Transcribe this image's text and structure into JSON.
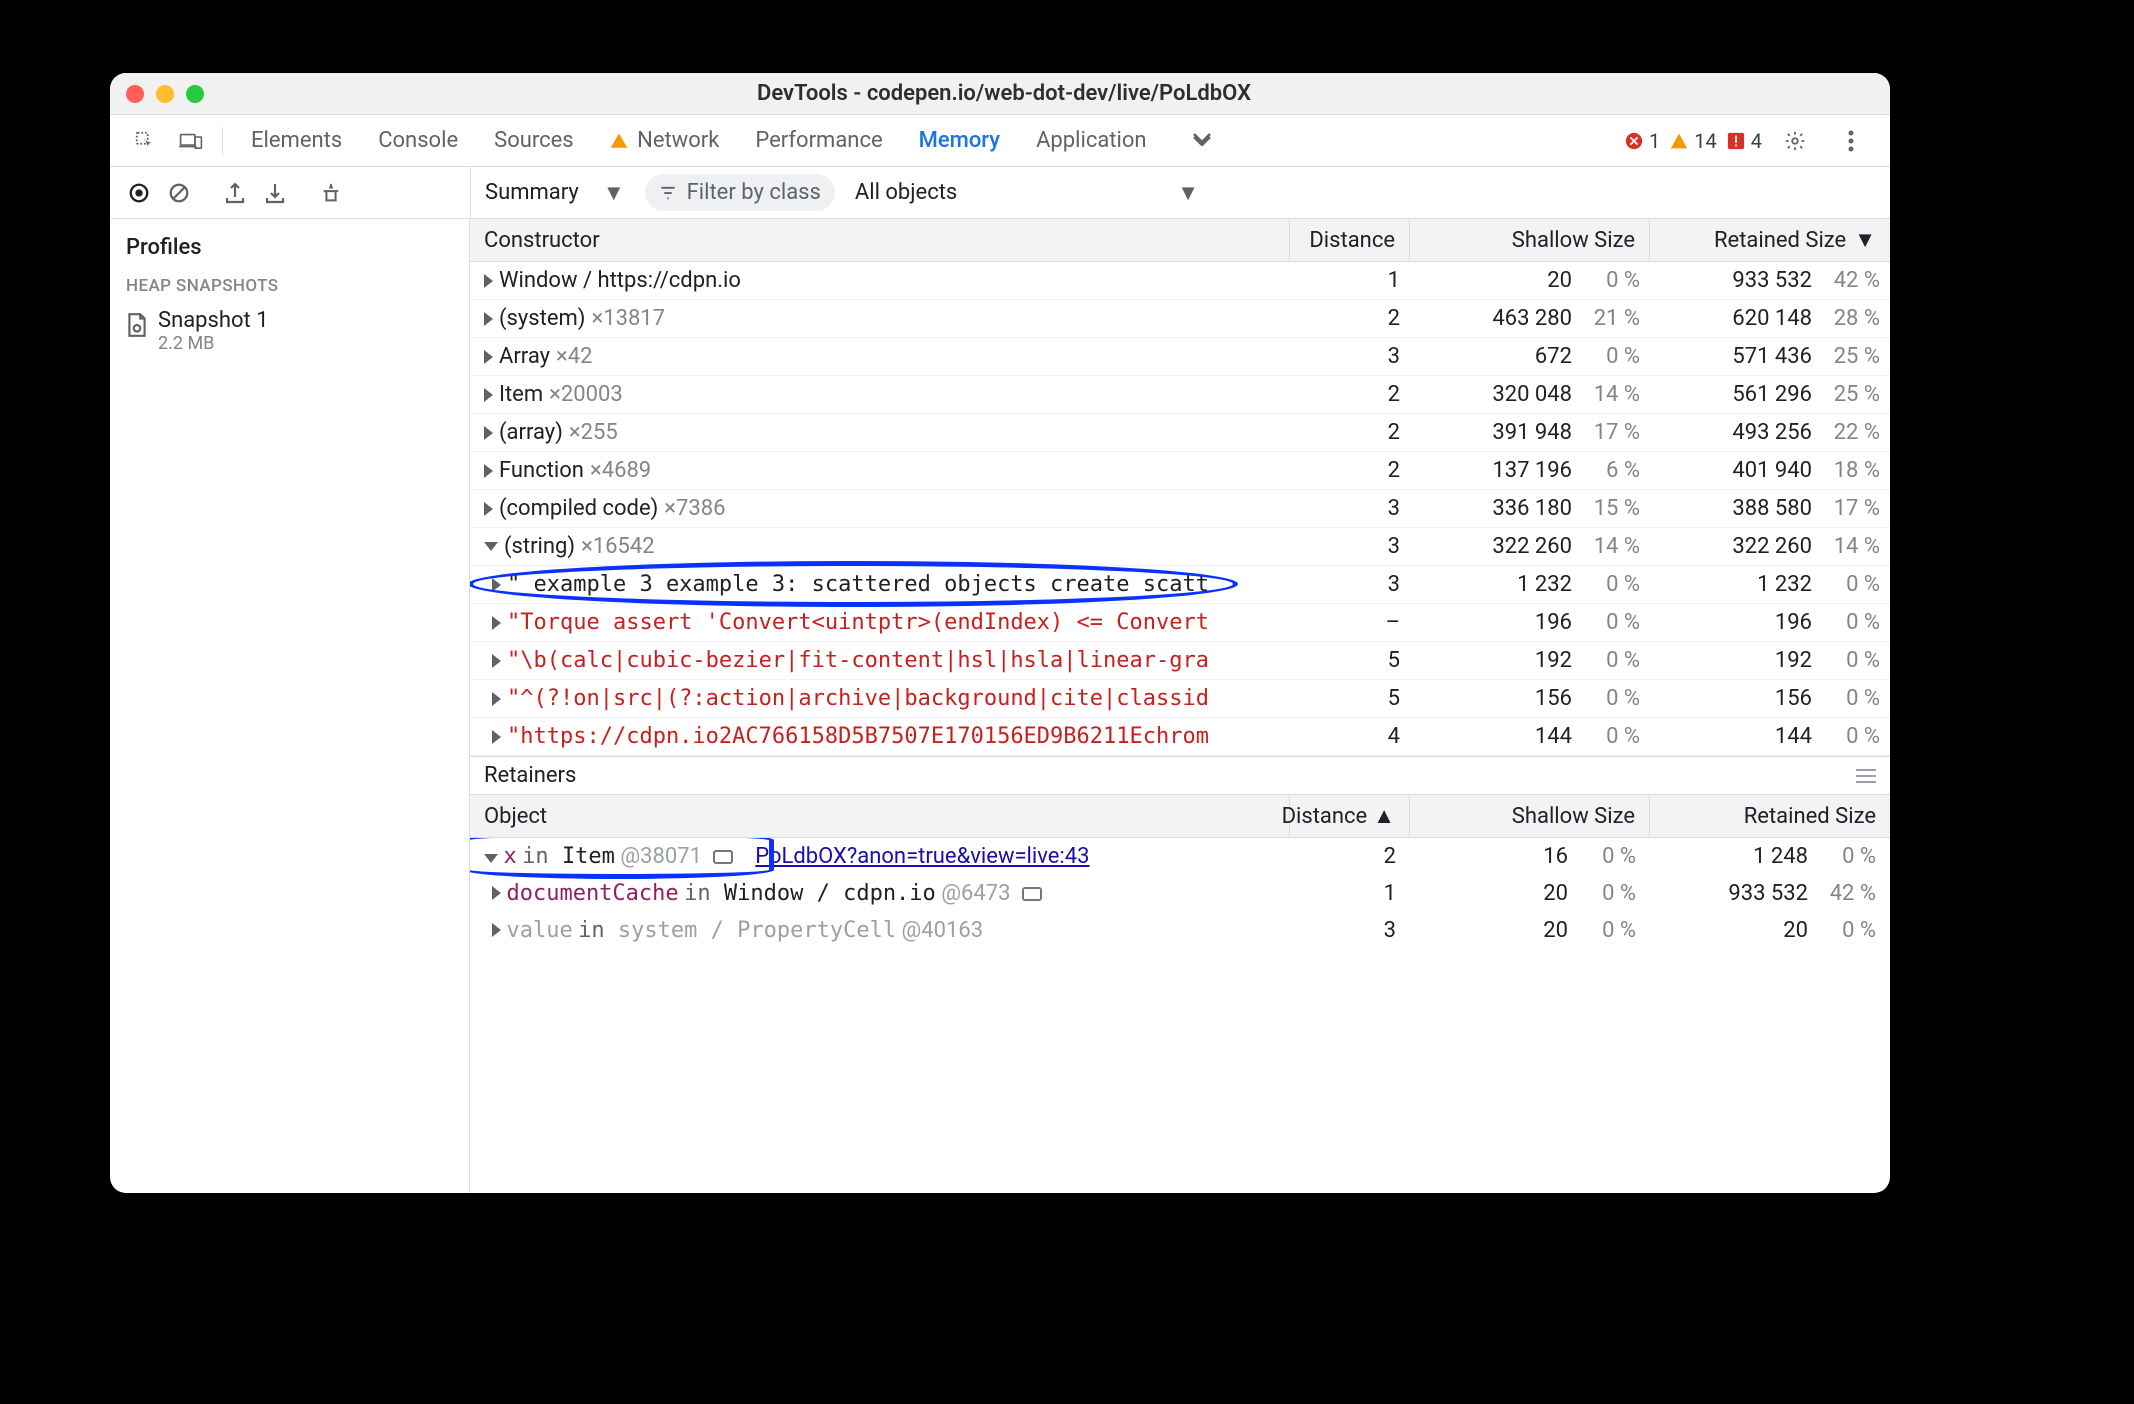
{
  "titlebar": {
    "title": "DevTools - codepen.io/web-dot-dev/live/PoLdbOX"
  },
  "tabs": {
    "elements": "Elements",
    "console": "Console",
    "sources": "Sources",
    "network": "Network",
    "performance": "Performance",
    "memory": "Memory",
    "application": "Application"
  },
  "status": {
    "errors": "1",
    "warnings": "14",
    "issues": "4"
  },
  "toolbar": {
    "summary": "Summary",
    "filter_placeholder": "Filter by class",
    "allobjects": "All objects"
  },
  "sidebar": {
    "profiles": "Profiles",
    "heap": "HEAP SNAPSHOTS",
    "snap1_title": "Snapshot 1",
    "snap1_size": "2.2 MB"
  },
  "grid": {
    "headers": {
      "constructor": "Constructor",
      "distance": "Distance",
      "shallow": "Shallow Size",
      "retained": "Retained Size"
    },
    "rows": [
      {
        "name": "Window / https://cdpn.io",
        "count": "",
        "d": "1",
        "sv": "20",
        "sp": "0 %",
        "rv": "933 532",
        "rp": "42 %",
        "expand": "r"
      },
      {
        "name": "(system)",
        "count": "×13817",
        "d": "2",
        "sv": "463 280",
        "sp": "21 %",
        "rv": "620 148",
        "rp": "28 %",
        "expand": "r"
      },
      {
        "name": "Array",
        "count": "×42",
        "d": "3",
        "sv": "672",
        "sp": "0 %",
        "rv": "571 436",
        "rp": "25 %",
        "expand": "r"
      },
      {
        "name": "Item",
        "count": "×20003",
        "d": "2",
        "sv": "320 048",
        "sp": "14 %",
        "rv": "561 296",
        "rp": "25 %",
        "expand": "r"
      },
      {
        "name": "(array)",
        "count": "×255",
        "d": "2",
        "sv": "391 948",
        "sp": "17 %",
        "rv": "493 256",
        "rp": "22 %",
        "expand": "r"
      },
      {
        "name": "Function",
        "count": "×4689",
        "d": "2",
        "sv": "137 196",
        "sp": "6 %",
        "rv": "401 940",
        "rp": "18 %",
        "expand": "r"
      },
      {
        "name": "(compiled code)",
        "count": "×7386",
        "d": "3",
        "sv": "336 180",
        "sp": "15 %",
        "rv": "388 580",
        "rp": "17 %",
        "expand": "r"
      },
      {
        "name": "(string)",
        "count": "×16542",
        "d": "3",
        "sv": "322 260",
        "sp": "14 %",
        "rv": "322 260",
        "rp": "14 %",
        "expand": "d"
      }
    ],
    "strings": [
      {
        "txt": "\" example 3 example 3: scattered objects create scatt",
        "d": "3",
        "sv": "1 232",
        "sp": "0 %",
        "rv": "1 232",
        "rp": "0 %",
        "hl": true
      },
      {
        "txt": "\"Torque assert 'Convert<uintptr>(endIndex) <= Convert",
        "d": "–",
        "sv": "196",
        "sp": "0 %",
        "rv": "196",
        "rp": "0 %"
      },
      {
        "txt": "\"\\b(calc|cubic-bezier|fit-content|hsl|hsla|linear-gra",
        "d": "5",
        "sv": "192",
        "sp": "0 %",
        "rv": "192",
        "rp": "0 %"
      },
      {
        "txt": "\"^(?!on|src|(?:action|archive|background|cite|classid",
        "d": "5",
        "sv": "156",
        "sp": "0 %",
        "rv": "156",
        "rp": "0 %"
      },
      {
        "txt": "\"https://cdpn.io2AC766158D5B7507E170156ED9B6211Echrom",
        "d": "4",
        "sv": "144",
        "sp": "0 %",
        "rv": "144",
        "rp": "0 %"
      }
    ]
  },
  "retainers": {
    "label": "Retainers",
    "headers": {
      "object": "Object",
      "distance": "Distance",
      "shallow": "Shallow Size",
      "retained": "Retained Size"
    },
    "rows": [
      {
        "sel": true,
        "expand": "d",
        "prop": "x",
        "in": "in",
        "obj": "Item",
        "at": "@38071",
        "frame": true,
        "link": "PoLdbOX?anon=true&view=live:43",
        "d": "2",
        "sv": "16",
        "sp": "0 %",
        "rv": "1 248",
        "rp": "0 %"
      },
      {
        "expand": "r",
        "prop": "documentCache",
        "in": "in",
        "obj": "Window / cdpn.io",
        "at": "@6473",
        "frame": true,
        "link": "",
        "d": "1",
        "sv": "20",
        "sp": "0 %",
        "rv": "933 532",
        "rp": "42 %"
      },
      {
        "expand": "r",
        "prop": "value",
        "in": "in",
        "obj": "system / PropertyCell",
        "at": "@40163",
        "gray": true,
        "d": "3",
        "sv": "20",
        "sp": "0 %",
        "rv": "20",
        "rp": "0 %"
      }
    ]
  }
}
